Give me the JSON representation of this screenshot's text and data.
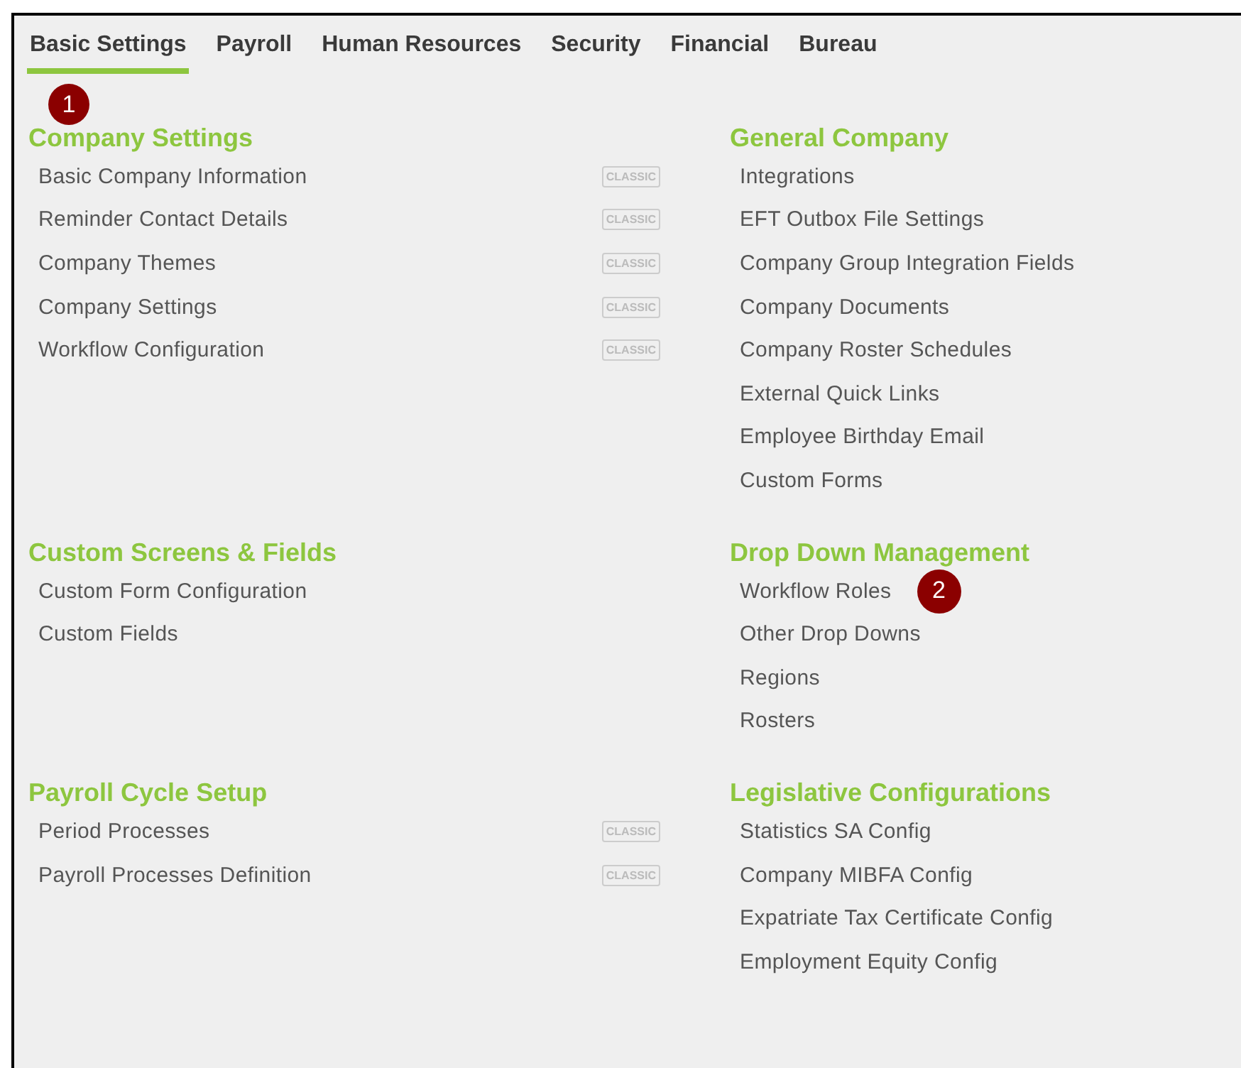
{
  "tabs": [
    {
      "label": "Basic Settings",
      "selected": true,
      "marker": "1"
    },
    {
      "label": "Payroll",
      "selected": false
    },
    {
      "label": "Human Resources",
      "selected": false
    },
    {
      "label": "Security",
      "selected": false
    },
    {
      "label": "Financial",
      "selected": false
    },
    {
      "label": "Bureau",
      "selected": false
    }
  ],
  "rows": [
    {
      "left": {
        "heading": "Company Settings",
        "items": [
          {
            "label": "Basic Company Information",
            "badge": "CLASSIC"
          },
          {
            "label": "Reminder Contact Details",
            "badge": "CLASSIC"
          },
          {
            "label": "Company Themes",
            "badge": "CLASSIC"
          },
          {
            "label": "Company Settings",
            "badge": "CLASSIC"
          },
          {
            "label": "Workflow Configuration",
            "badge": "CLASSIC"
          }
        ]
      },
      "right": {
        "heading": "General Company",
        "items": [
          {
            "label": "Integrations"
          },
          {
            "label": "EFT Outbox File Settings"
          },
          {
            "label": "Company Group Integration Fields"
          },
          {
            "label": "Company Documents"
          },
          {
            "label": "Company Roster Schedules"
          },
          {
            "label": "External Quick Links"
          },
          {
            "label": "Employee Birthday Email"
          },
          {
            "label": "Custom Forms"
          }
        ]
      }
    },
    {
      "left": {
        "heading": "Custom Screens & Fields",
        "items": [
          {
            "label": "Custom Form Configuration"
          },
          {
            "label": "Custom Fields"
          }
        ]
      },
      "right": {
        "heading": "Drop Down Management",
        "items": [
          {
            "label": "Workflow Roles",
            "marker": "2"
          },
          {
            "label": "Other Drop Downs"
          },
          {
            "label": "Regions"
          },
          {
            "label": "Rosters"
          }
        ]
      }
    },
    {
      "left": {
        "heading": "Payroll Cycle Setup",
        "items": [
          {
            "label": "Period Processes",
            "badge": "CLASSIC"
          },
          {
            "label": "Payroll Processes Definition",
            "badge": "CLASSIC"
          }
        ]
      },
      "right": {
        "heading": "Legislative Configurations",
        "items": [
          {
            "label": "Statistics SA Config"
          },
          {
            "label": "Company MIBFA Config"
          },
          {
            "label": "Expatriate Tax Certificate Config"
          },
          {
            "label": "Employment Equity Config"
          }
        ]
      }
    }
  ]
}
